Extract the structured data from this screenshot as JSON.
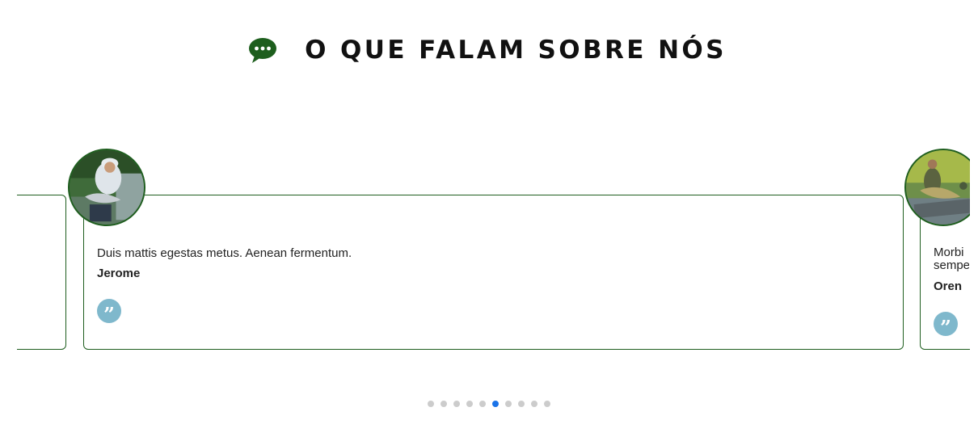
{
  "header": {
    "title": "O QUE FALAM SOBRE NÓS",
    "icon": "chat-bubble-icon",
    "icon_color": "#1d5e1d"
  },
  "testimonials": [
    {
      "text": "Duis mattis egestas metus. Aenean fermentum.",
      "author": "Jerome"
    },
    {
      "text": "Morbi sempe",
      "author": "Oren"
    }
  ],
  "carousel": {
    "dot_count": 10,
    "active_index": 5
  },
  "colors": {
    "card_border": "#1f5e1f",
    "quote_badge": "#7fb8cc",
    "active_dot": "#1a73e8",
    "inactive_dot": "#cccccc"
  }
}
